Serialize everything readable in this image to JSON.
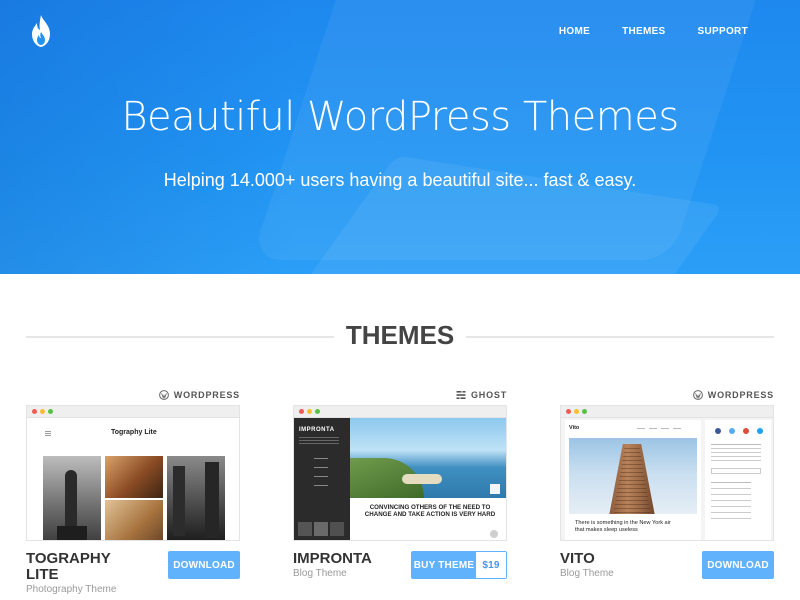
{
  "nav": {
    "items": [
      "HOME",
      "THEMES",
      "SUPPORT"
    ]
  },
  "hero": {
    "title": "Beautiful WordPress Themes",
    "tagline": "Helping 14.000+ users having a beautiful site... fast & easy."
  },
  "section": {
    "title": "THEMES"
  },
  "themes": [
    {
      "platform": "WORDPRESS",
      "platform_icon": "wordpress-icon",
      "preview_title": "Tography Lite",
      "name_line1": "TOGRAPHY",
      "name_line2": "LITE",
      "subtitle": "Photography Theme",
      "button": "DOWNLOAD"
    },
    {
      "platform": "GHOST",
      "platform_icon": "ghost-icon",
      "preview_title": "IMPRONTA",
      "preview_headline": "CONVINCING OTHERS OF THE NEED TO CHANGE AND TAKE ACTION IS VERY HARD",
      "name_line1": "IMPRONTA",
      "subtitle": "Blog Theme",
      "button": "BUY THEME",
      "price": "$19"
    },
    {
      "platform": "WORDPRESS",
      "platform_icon": "wordpress-icon",
      "preview_title": "Vito",
      "preview_headline": "There is something in the New York air that makes sleep useless",
      "name_line1": "VITO",
      "subtitle": "Blog Theme",
      "button": "DOWNLOAD"
    }
  ],
  "colors": {
    "hero": "#2194f3",
    "button": "#61b2fd",
    "price_text": "#3e98f1"
  }
}
